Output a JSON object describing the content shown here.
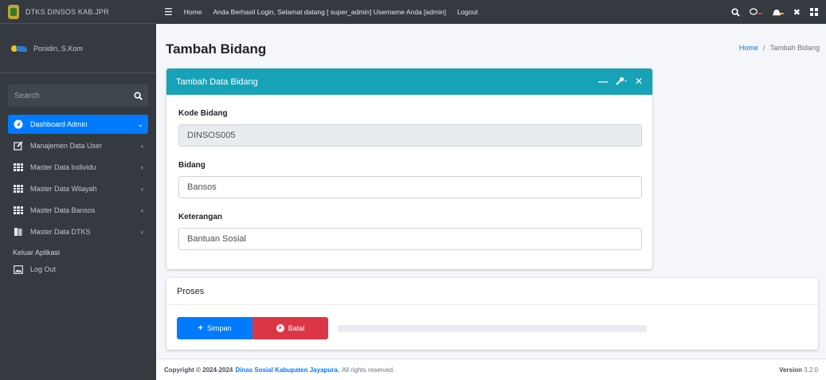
{
  "brand": {
    "text": "DTKS DINSOS KAB.JPR"
  },
  "user": {
    "name": "Ponidin, S.Kom"
  },
  "search": {
    "placeholder": "Search"
  },
  "sidebar": {
    "items": [
      {
        "label": "Dashboard Admin",
        "icon": "dashboard-icon"
      },
      {
        "label": "Manajemen Data User",
        "icon": "edit-icon"
      },
      {
        "label": "Master Data Individu",
        "icon": "table-icon"
      },
      {
        "label": "Master Data Wilayah",
        "icon": "table-icon"
      },
      {
        "label": "Master Data Bansos",
        "icon": "table-icon"
      },
      {
        "label": "Master Data DTKS",
        "icon": "book-icon"
      }
    ],
    "section_header": "Keluar Aplikasi",
    "logout_label": "Log Out"
  },
  "navbar": {
    "home": "Home",
    "welcome": "Anda Berhasil Login, Selamat datang [ super_admin] Username Anda [admin]",
    "logout": "Logout"
  },
  "page": {
    "title": "Tambah Bidang",
    "breadcrumb_home": "Home",
    "breadcrumb_current": "Tambah Bidang"
  },
  "form": {
    "card_title": "Tambah Data Bidang",
    "kode_label": "Kode Bidang",
    "kode_value": "DINSOS005",
    "bidang_label": "Bidang",
    "bidang_value": "Bansos",
    "keterangan_label": "Keterangan",
    "keterangan_value": "Bantuan Sosial"
  },
  "proses": {
    "title": "Proses",
    "save_label": "Simpan",
    "cancel_label": "Batal",
    "progress": 0
  },
  "footer": {
    "copyright": "Copyright © 2024-2024",
    "org": "Dinas Sosial Kabupaten Jayapura.",
    "rights": "All rights reserved.",
    "version_label": "Version",
    "version_number": "3.2.0"
  },
  "colors": {
    "sidebar_bg": "#343a40",
    "primary": "#007bff",
    "info": "#17a2b8",
    "danger": "#dc3545"
  }
}
